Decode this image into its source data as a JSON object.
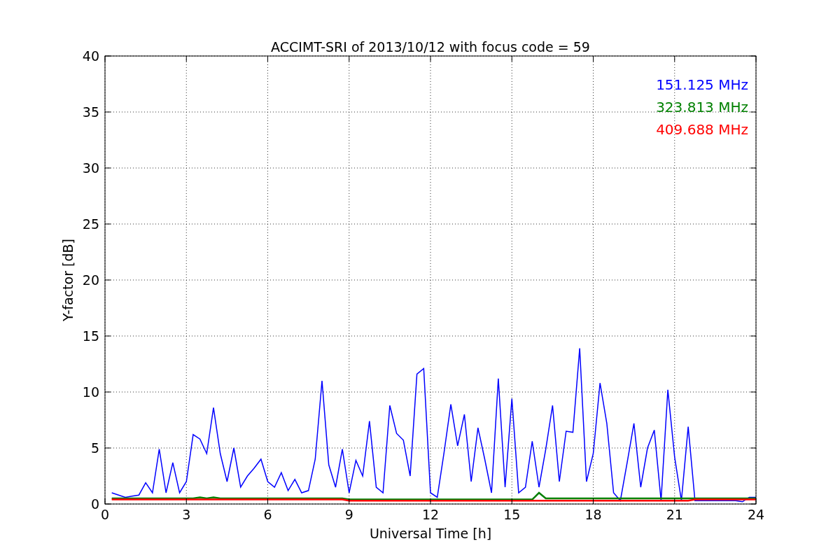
{
  "figure": {
    "chart_data": {
      "type": "line",
      "title": "ACCIMT-SRI of 2013/10/12 with focus code = 59",
      "xlabel": "Universal Time [h]",
      "ylabel": "Y-factor [dB]",
      "x": [
        0.25,
        0.5,
        0.75,
        1,
        1.25,
        1.5,
        1.75,
        2,
        2.25,
        2.5,
        2.75,
        3,
        3.25,
        3.5,
        3.75,
        4,
        4.25,
        4.5,
        4.75,
        5,
        5.25,
        5.5,
        5.75,
        6,
        6.25,
        6.5,
        6.75,
        7,
        7.25,
        7.5,
        7.75,
        8,
        8.25,
        8.5,
        8.75,
        9,
        9.25,
        9.5,
        9.75,
        10,
        10.25,
        10.5,
        10.75,
        11,
        11.25,
        11.5,
        11.75,
        12,
        12.25,
        12.5,
        12.75,
        13,
        13.25,
        13.5,
        13.75,
        14,
        14.25,
        14.5,
        14.75,
        15,
        15.25,
        15.5,
        15.75,
        16,
        16.25,
        16.5,
        16.75,
        17,
        17.25,
        17.5,
        17.75,
        18,
        18.25,
        18.5,
        18.75,
        19,
        19.25,
        19.5,
        19.75,
        20,
        20.25,
        20.5,
        20.75,
        21,
        21.25,
        21.5,
        21.75,
        22,
        22.25,
        22.5,
        22.75,
        23,
        23.25,
        23.5,
        23.75,
        24
      ],
      "series": [
        {
          "name": "151.125 MHz",
          "color": "#0000ff",
          "values": [
            1.0,
            0.8,
            0.6,
            0.7,
            0.8,
            1.9,
            1.0,
            4.9,
            1.0,
            3.7,
            1.0,
            2.0,
            6.2,
            5.8,
            4.5,
            8.6,
            4.5,
            2.0,
            5.0,
            1.5,
            2.5,
            3.2,
            4.0,
            2.0,
            1.5,
            2.8,
            1.2,
            2.2,
            1.0,
            1.2,
            4.0,
            11.0,
            3.5,
            1.5,
            4.9,
            1.0,
            3.9,
            2.5,
            7.4,
            1.5,
            1.0,
            8.8,
            6.3,
            5.7,
            2.5,
            11.6,
            12.1,
            1.0,
            0.6,
            4.6,
            8.9,
            5.2,
            8.0,
            2.0,
            6.8,
            4.0,
            1.0,
            11.2,
            1.5,
            9.4,
            1.0,
            1.5,
            5.6,
            1.5,
            4.9,
            8.8,
            2.0,
            6.5,
            6.4,
            13.9,
            2.0,
            4.5,
            10.8,
            7.2,
            1.0,
            0.3,
            3.7,
            7.2,
            1.5,
            5.0,
            6.6,
            0.3,
            10.2,
            4.2,
            0.3,
            6.9,
            0.3,
            0.3,
            0.3,
            0.3,
            0.3,
            0.3,
            0.3,
            0.2,
            0.6,
            0.6
          ]
        },
        {
          "name": "323.813 MHz",
          "color": "#008000",
          "values": [
            0.5,
            0.5,
            0.5,
            0.5,
            0.5,
            0.5,
            0.5,
            0.5,
            0.5,
            0.5,
            0.5,
            0.5,
            0.5,
            0.6,
            0.5,
            0.6,
            0.5,
            0.5,
            0.5,
            0.5,
            0.5,
            0.5,
            0.5,
            0.5,
            0.5,
            0.5,
            0.5,
            0.5,
            0.5,
            0.5,
            0.5,
            0.5,
            0.5,
            0.5,
            0.5,
            0.4,
            0.4,
            0.4,
            0.4,
            0.4,
            0.4,
            0.4,
            0.4,
            0.4,
            0.4,
            0.4,
            0.4,
            0.4,
            0.4,
            0.4,
            0.4,
            0.4,
            0.4,
            0.4,
            0.4,
            0.4,
            0.4,
            0.4,
            0.4,
            0.4,
            0.4,
            0.4,
            0.4,
            1.0,
            0.5,
            0.5,
            0.5,
            0.5,
            0.5,
            0.5,
            0.5,
            0.5,
            0.5,
            0.5,
            0.5,
            0.5,
            0.5,
            0.5,
            0.5,
            0.5,
            0.5,
            0.5,
            0.5,
            0.5,
            0.5,
            0.5,
            0.5,
            0.5,
            0.5,
            0.5,
            0.5,
            0.5,
            0.5,
            0.5,
            0.5,
            0.5
          ]
        },
        {
          "name": "409.688 MHz",
          "color": "#ff0000",
          "values": [
            0.4,
            0.4,
            0.4,
            0.4,
            0.4,
            0.4,
            0.4,
            0.4,
            0.4,
            0.4,
            0.4,
            0.4,
            0.4,
            0.4,
            0.4,
            0.4,
            0.4,
            0.4,
            0.4,
            0.4,
            0.4,
            0.4,
            0.4,
            0.4,
            0.4,
            0.4,
            0.4,
            0.4,
            0.4,
            0.4,
            0.4,
            0.4,
            0.4,
            0.4,
            0.4,
            0.3,
            0.3,
            0.3,
            0.3,
            0.3,
            0.3,
            0.3,
            0.3,
            0.3,
            0.3,
            0.3,
            0.3,
            0.3,
            0.3,
            0.3,
            0.3,
            0.3,
            0.3,
            0.3,
            0.3,
            0.3,
            0.3,
            0.3,
            0.3,
            0.3,
            0.3,
            0.3,
            0.3,
            0.3,
            0.3,
            0.3,
            0.3,
            0.3,
            0.3,
            0.3,
            0.3,
            0.3,
            0.3,
            0.3,
            0.3,
            0.3,
            0.3,
            0.3,
            0.3,
            0.3,
            0.3,
            0.3,
            0.3,
            0.3,
            0.3,
            0.3,
            0.4,
            0.4,
            0.4,
            0.4,
            0.4,
            0.4,
            0.4,
            0.4,
            0.4,
            0.4
          ]
        }
      ],
      "grid": true,
      "xlim": [
        0,
        24
      ],
      "ylim": [
        0,
        40
      ],
      "xticks": [
        0,
        3,
        6,
        9,
        12,
        15,
        18,
        21,
        24
      ],
      "yticks": [
        0,
        5,
        10,
        15,
        20,
        25,
        30,
        35,
        40
      ]
    }
  }
}
